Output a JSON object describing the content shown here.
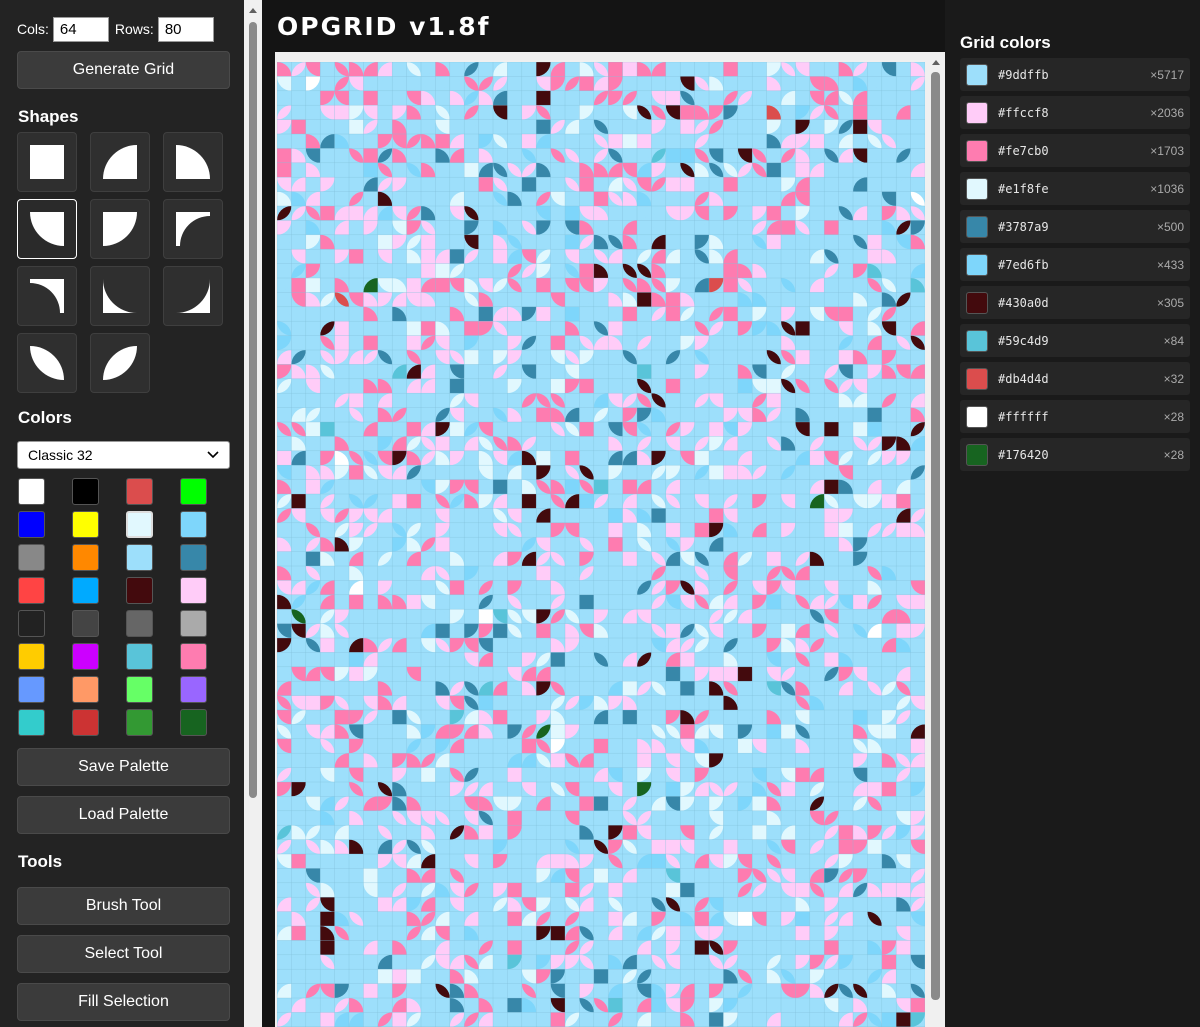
{
  "sidebar": {
    "cols_label": "Cols:",
    "cols_value": "64",
    "rows_label": "Rows:",
    "rows_value": "80",
    "generate_label": "Generate Grid",
    "shapes_title": "Shapes",
    "shapes": [
      "square",
      "quarter-circle-top-left",
      "quarter-circle-top-right",
      "quarter-circle-bottom-left",
      "quarter-circle-bottom-right",
      "concave-top-left",
      "concave-top-right",
      "concave-bottom-left",
      "concave-bottom-right",
      "leaf-down",
      "leaf-up"
    ],
    "selected_shape": "quarter-circle-bottom-left",
    "colors_title": "Colors",
    "palette_name": "Classic 32",
    "swatches": [
      "#ffffff",
      "#000000",
      "#db4d4d",
      "#00ff00",
      "#0000ff",
      "#ffff00",
      "#e1f8fe",
      "#7ed6fb",
      "#888888",
      "#ff8800",
      "#9ddffb",
      "#3787a9",
      "#ff4444",
      "#00aaff",
      "#430a0d",
      "#ffccf8",
      "#222222",
      "#444444",
      "#666666",
      "#aaaaaa",
      "#ffcc00",
      "#cc00ff",
      "#59c4d9",
      "#fe7cb0",
      "#6699ff",
      "#ff9966",
      "#66ff66",
      "#9966ff",
      "#33cccc",
      "#cc3333",
      "#339933",
      "#176420"
    ],
    "selected_swatch": 6,
    "save_palette_label": "Save Palette",
    "load_palette_label": "Load Palette",
    "tools_title": "Tools",
    "brush_label": "Brush Tool",
    "select_label": "Select Tool",
    "fill_label": "Fill Selection"
  },
  "main": {
    "title": "OPGRID v1.8f"
  },
  "grid_colors": {
    "title": "Grid colors",
    "items": [
      {
        "hex": "#9ddffb",
        "count": "×5717"
      },
      {
        "hex": "#ffccf8",
        "count": "×2036"
      },
      {
        "hex": "#fe7cb0",
        "count": "×1703"
      },
      {
        "hex": "#e1f8fe",
        "count": "×1036"
      },
      {
        "hex": "#3787a9",
        "count": "×500"
      },
      {
        "hex": "#7ed6fb",
        "count": "×433"
      },
      {
        "hex": "#430a0d",
        "count": "×305"
      },
      {
        "hex": "#59c4d9",
        "count": "×84"
      },
      {
        "hex": "#db4d4d",
        "count": "×32"
      },
      {
        "hex": "#ffffff",
        "count": "×28"
      },
      {
        "hex": "#176420",
        "count": "×28"
      }
    ]
  }
}
